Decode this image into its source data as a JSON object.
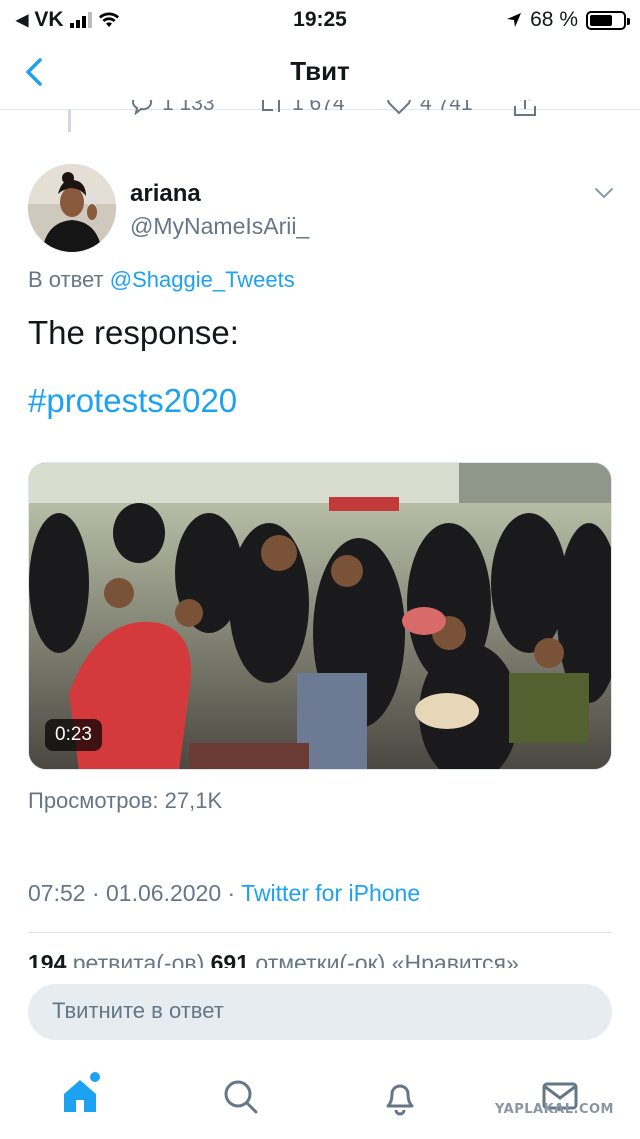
{
  "status_bar": {
    "carrier": "VK",
    "time": "19:25",
    "battery_text": "68 %",
    "battery_level": 0.68
  },
  "nav": {
    "title": "Твит"
  },
  "prev_tweet": {
    "replies": "1 133",
    "retweets": "1 674",
    "likes": "4 741"
  },
  "tweet": {
    "user_name": "ariana",
    "user_handle": "@MyNameIsArii_",
    "reply_prefix": "В ответ",
    "reply_to": "@Shaggie_Tweets",
    "text": "The response:",
    "hashtag": "#protests2020",
    "video_duration": "0:23",
    "views": "Просмотров: 27,1K",
    "time": "07:52",
    "date": "01.06.2020",
    "source": "Twitter for iPhone",
    "retweets_count": "194",
    "retweets_label": "ретвита(-ов)",
    "likes_count": "691",
    "likes_label": "отметки(-ок) «Нравится»"
  },
  "reply_bar": {
    "placeholder": "Твитните в ответ"
  },
  "tabs": {
    "home": "home-icon",
    "search": "search-icon",
    "notifications": "bell-icon",
    "messages": "mail-icon"
  },
  "watermark": "YAPLAKAL.COM",
  "colors": {
    "accent": "#1da1f2",
    "secondary_text": "#657786",
    "primary_text": "#14171a"
  }
}
